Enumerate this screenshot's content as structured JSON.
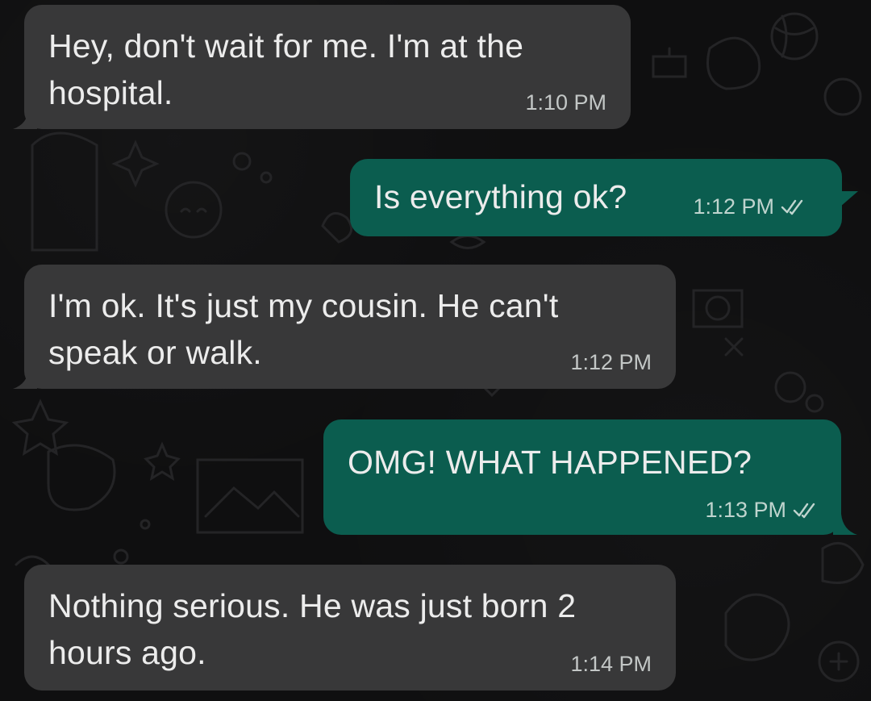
{
  "messages": [
    {
      "direction": "incoming",
      "text": "Hey, don't wait for me. I'm at the hospital.",
      "time": "1:10 PM"
    },
    {
      "direction": "outgoing",
      "text": "Is everything ok?",
      "time": "1:12 PM",
      "status": "double-check-icon"
    },
    {
      "direction": "incoming",
      "text": "I'm ok. It's just my cousin. He can't speak or walk.",
      "time": "1:12 PM"
    },
    {
      "direction": "outgoing",
      "text": "OMG! WHAT HAPPENED?",
      "time": "1:13 PM",
      "status": "double-check-icon"
    },
    {
      "direction": "incoming",
      "text": "Nothing serious. He was just born 2 hours ago.",
      "time": "1:14 PM"
    }
  ],
  "colors": {
    "background": "#0f0f10",
    "incoming_bubble": "#383839",
    "outgoing_bubble": "#0b5d4f",
    "text": "#ececec",
    "timestamp": "#c3c7c6"
  }
}
